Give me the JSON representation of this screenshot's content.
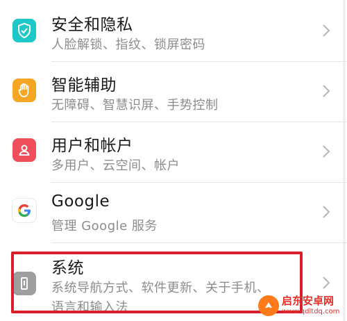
{
  "items": [
    {
      "title": "安全和隐私",
      "subtitle": "人脸解锁、指纹、锁屏密码",
      "icon": "shield-check-icon",
      "color": "#1fc8c8"
    },
    {
      "title": "智能辅助",
      "subtitle": "无障碍、智慧识屏、手势控制",
      "icon": "hand-icon",
      "color": "#f5a623"
    },
    {
      "title": "用户和帐户",
      "subtitle": "多用户、云空间、帐户",
      "icon": "user-icon",
      "color": "#f04e5a"
    },
    {
      "title": "Google",
      "subtitle": "管理 Google 服务",
      "icon": "google-icon",
      "color": "#ffffff"
    },
    {
      "title": "系统",
      "subtitle": "系统导航方式、软件更新、关于手机、",
      "subtitle2": "语言和输入法",
      "icon": "phone-icon",
      "color": "#9e9e9e"
    }
  ],
  "watermark": {
    "title": "启东安卓网",
    "url": "www.qdltdq.com"
  },
  "colors": {
    "highlight": "#d81f2b",
    "divider": "#e6e6e6"
  }
}
